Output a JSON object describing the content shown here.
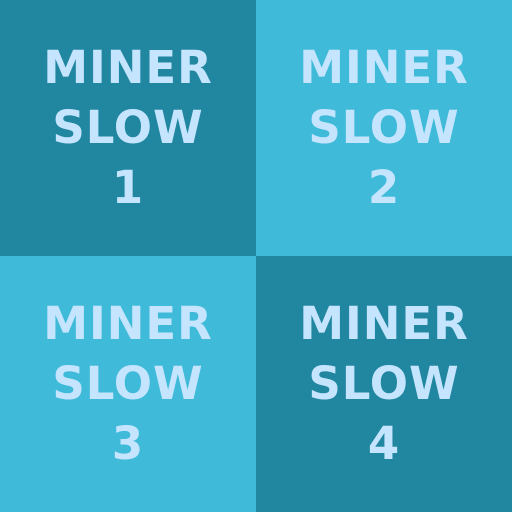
{
  "colors": {
    "dark_tile": "#2186a0",
    "light_tile": "#3fbad9",
    "text": "#c5e5ff"
  },
  "tiles": [
    {
      "line1": "MINER",
      "line2": "SLOW",
      "number": "1",
      "shade": "dark"
    },
    {
      "line1": "MINER",
      "line2": "SLOW",
      "number": "2",
      "shade": "light"
    },
    {
      "line1": "MINER",
      "line2": "SLOW",
      "number": "3",
      "shade": "light"
    },
    {
      "line1": "MINER",
      "line2": "SLOW",
      "number": "4",
      "shade": "dark"
    }
  ]
}
